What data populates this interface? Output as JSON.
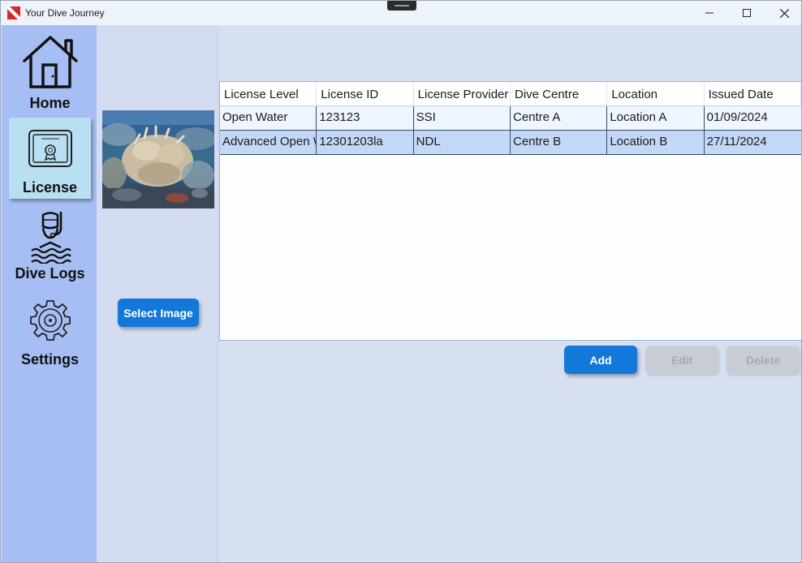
{
  "window": {
    "title": "Your Dive Journey"
  },
  "sidebar": {
    "items": [
      {
        "label": "Home",
        "icon": "home-icon"
      },
      {
        "label": "License",
        "icon": "certificate-icon",
        "active": true
      },
      {
        "label": "Dive Logs",
        "icon": "diver-icon"
      },
      {
        "label": "Settings",
        "icon": "gear-icon"
      }
    ]
  },
  "image_panel": {
    "select_label": "Select Image"
  },
  "table": {
    "columns": [
      "License Level",
      "License ID",
      "License Provider",
      "Dive Centre",
      "Location",
      "Issued Date"
    ],
    "rows": [
      [
        "Open Water",
        "123123",
        "SSI",
        "Centre A",
        "Location A",
        "01/09/2024"
      ],
      [
        "Advanced Open Water",
        "12301203la",
        "NDL",
        "Centre B",
        "Location B",
        "27/11/2024"
      ]
    ]
  },
  "actions": {
    "add_label": "Add",
    "edit_label": "Edit",
    "delete_label": "Delete"
  },
  "colors": {
    "accent": "#1278d9",
    "sidebar": "#a6bef3",
    "active_nav": "#b8e0f2",
    "selected_row": "#c3d8f7"
  }
}
